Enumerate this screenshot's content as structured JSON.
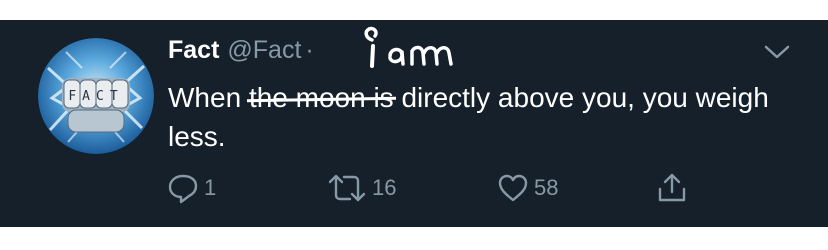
{
  "tweet": {
    "author": {
      "display_name": "Fact",
      "handle": "@Fact",
      "separator": "·",
      "avatar_text": "FACT"
    },
    "handwritten_annotation": "i am",
    "text": {
      "before": "When ",
      "struck": "the moon is",
      "after": " directly above you, you weigh less."
    },
    "actions": {
      "replies": "1",
      "retweets": "16",
      "likes": "58"
    }
  },
  "colors": {
    "background": "#15202b",
    "primary_text": "#ffffff",
    "secondary_text": "#8899a6"
  },
  "icons": [
    "chevron-down-icon",
    "reply-icon",
    "retweet-icon",
    "like-icon",
    "share-icon"
  ]
}
